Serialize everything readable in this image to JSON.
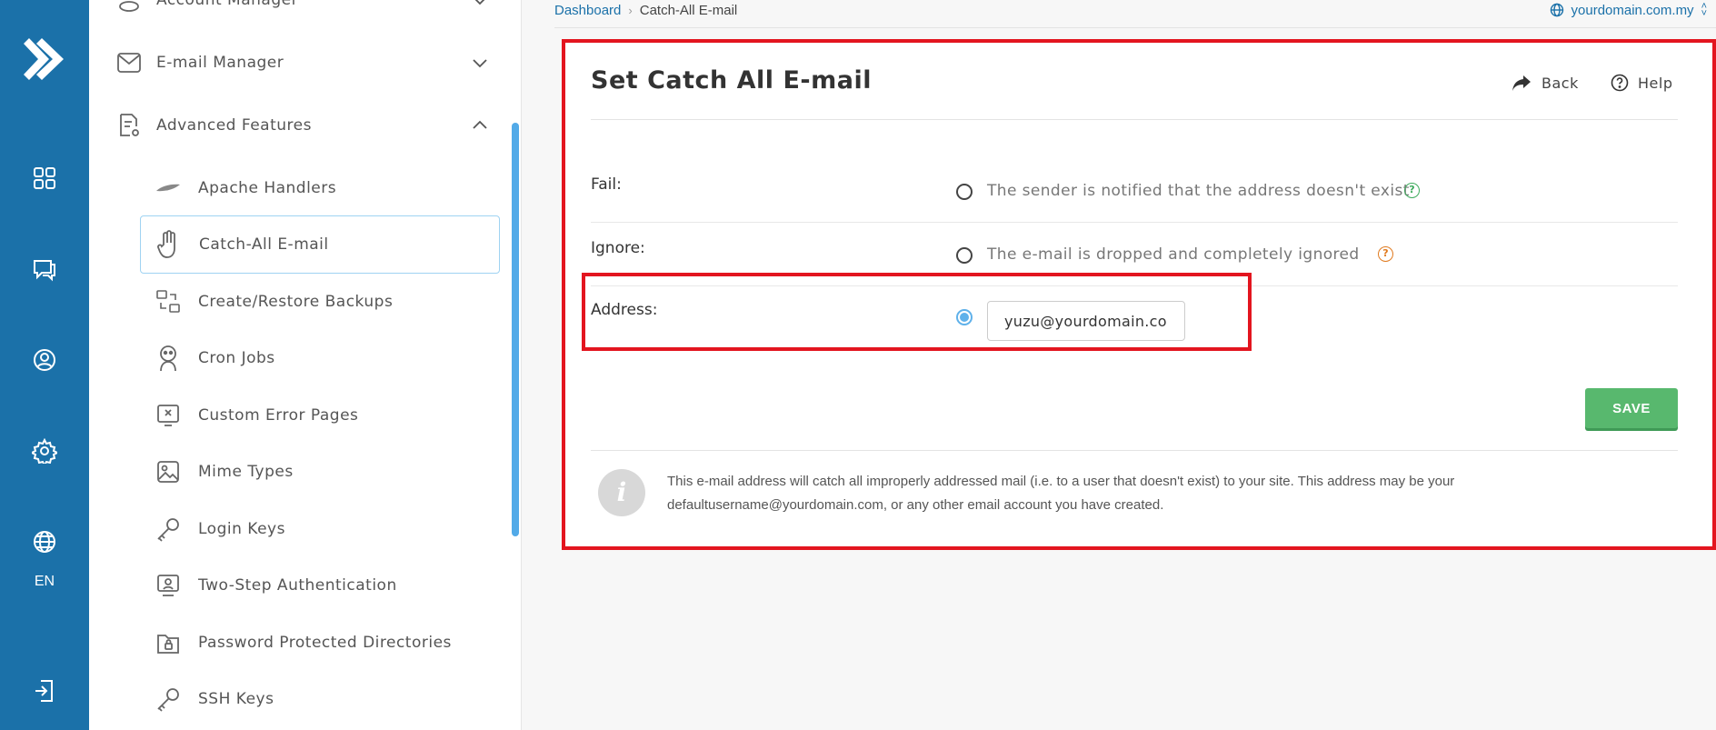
{
  "rail": {
    "language": "EN"
  },
  "sidebar": {
    "sections": [
      {
        "label": "Account Manager"
      },
      {
        "label": "E-mail Manager"
      },
      {
        "label": "Advanced Features"
      }
    ],
    "items": [
      {
        "label": "Apache Handlers"
      },
      {
        "label": "Catch-All E-mail"
      },
      {
        "label": "Create/Restore Backups"
      },
      {
        "label": "Cron Jobs"
      },
      {
        "label": "Custom Error Pages"
      },
      {
        "label": "Mime Types"
      },
      {
        "label": "Login Keys"
      },
      {
        "label": "Two-Step Authentication"
      },
      {
        "label": "Password Protected Directories"
      },
      {
        "label": "SSH Keys"
      }
    ]
  },
  "breadcrumb": {
    "home": "Dashboard",
    "current": "Catch-All E-mail"
  },
  "domain_selector": {
    "value": "yourdomain.com.my"
  },
  "panel": {
    "title": "Set Catch All E-mail",
    "back_label": "Back",
    "help_label": "Help",
    "options": [
      {
        "label": "Fail:",
        "text": "The sender is notified that the address doesn't exist",
        "help_color": "#3daa5c"
      },
      {
        "label": "Ignore:",
        "text": "The e-mail is dropped and completely ignored",
        "help_color": "#e07a1f"
      },
      {
        "label": "Address:",
        "value": "yuzu@yourdomain.com"
      }
    ],
    "save_label": "SAVE",
    "info_text": "This e-mail address will catch all improperly addressed mail (i.e. to a user that doesn't exist) to your site. This address may be your defaultusername@yourdomain.com, or any other email account you have created."
  },
  "colors": {
    "rail": "#1b71a9",
    "highlight": "#e3151f",
    "save": "#58b86e",
    "selected_radio": "#5fb1ea"
  }
}
